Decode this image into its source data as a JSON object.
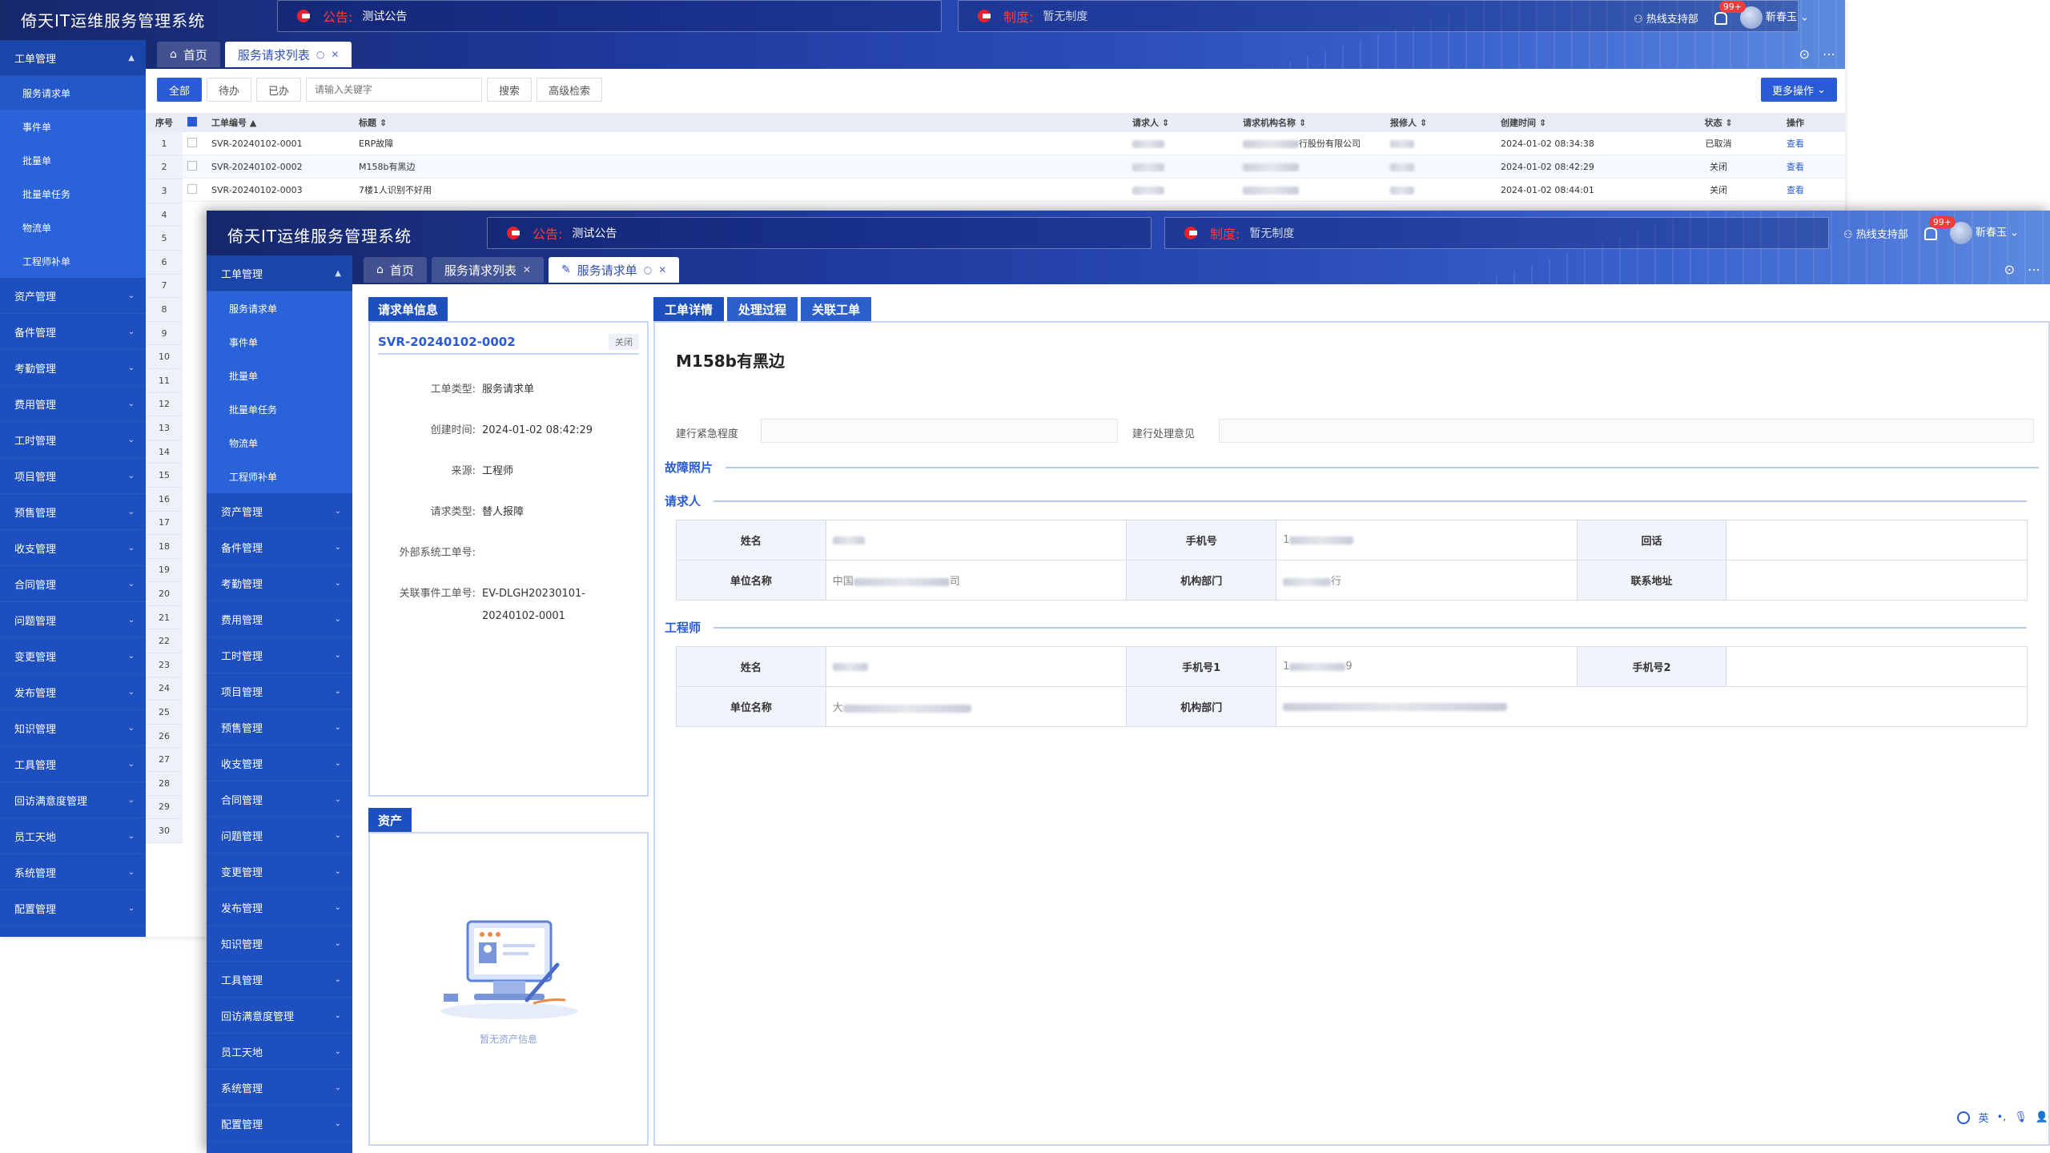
{
  "app": {
    "title": "倚天IT运维服务管理系统",
    "notice_tag": "公告:",
    "notice_text": "测试公告",
    "policy_tag": "制度:",
    "policy_text": "暂无制度",
    "hotline": "热线支持部",
    "badge": "99+",
    "user": "靳春玉"
  },
  "back": {
    "tabs": [
      "首页",
      "服务请求列表"
    ],
    "toolbar": {
      "all": "全部",
      "pending": "待办",
      "done": "已办",
      "search_placeholder": "请输入关键字",
      "search": "搜索",
      "advanced": "高级检索",
      "more": "更多操作"
    },
    "columns": {
      "seq": "序号",
      "code": "工单编号",
      "title": "标题",
      "requester": "请求人",
      "org": "请求机构名称",
      "reporter": "报修人",
      "created": "创建时间",
      "status": "状态",
      "action": "操作"
    },
    "rows": [
      {
        "code": "SVR-20240102-0001",
        "title": "ERP故障",
        "org_suffix": "行股份有限公司",
        "created": "2024-01-02 08:34:38",
        "status": "已取消",
        "action": "查看"
      },
      {
        "code": "SVR-20240102-0002",
        "title": "M158b有黑边",
        "org_suffix": "",
        "created": "2024-01-02 08:42:29",
        "status": "关闭",
        "action": "查看"
      },
      {
        "code": "SVR-20240102-0003",
        "title": "7楼1人识别不好用",
        "org_suffix": "",
        "created": "2024-01-02 08:44:01",
        "status": "关闭",
        "action": "查看"
      }
    ],
    "row_numbers": [
      "1",
      "2",
      "3",
      "4",
      "5",
      "6",
      "7",
      "8",
      "9",
      "10",
      "11",
      "12",
      "13",
      "14",
      "15",
      "16",
      "17",
      "18",
      "19",
      "20",
      "21",
      "22",
      "23",
      "24",
      "25",
      "26",
      "27",
      "28",
      "29",
      "30"
    ]
  },
  "sidebar": {
    "open_group": "工单管理",
    "sub_items": [
      "服务请求单",
      "事件单",
      "批量单",
      "批量单任务",
      "物流单",
      "工程师补单"
    ],
    "groups": [
      "资产管理",
      "备件管理",
      "考勤管理",
      "费用管理",
      "工时管理",
      "项目管理",
      "预售管理",
      "收支管理",
      "合同管理",
      "问题管理",
      "变更管理",
      "发布管理",
      "知识管理",
      "工具管理",
      "回访满意度管理",
      "员工天地",
      "系统管理",
      "配置管理"
    ]
  },
  "front": {
    "tabs": [
      "首页",
      "服务请求列表",
      "服务请求单"
    ],
    "info": {
      "tag": "请求单信息",
      "code": "SVR-20240102-0002",
      "status": "关闭",
      "fields": [
        {
          "k": "工单类型:",
          "v": "服务请求单"
        },
        {
          "k": "创建时间:",
          "v": "2024-01-02 08:42:29"
        },
        {
          "k": "来源:",
          "v": "工程师"
        },
        {
          "k": "请求类型:",
          "v": "替人报障"
        },
        {
          "k": "外部系统工单号:",
          "v": ""
        },
        {
          "k": "关联事件工单号:",
          "v": "EV-DLGH20230101-20240102-0001"
        }
      ]
    },
    "asset": {
      "tag": "资产",
      "empty": "暂无资产信息"
    },
    "detail": {
      "tabs": [
        "工单详情",
        "处理过程",
        "关联工单"
      ],
      "title": "M158b有黑边",
      "urgency_label": "建行紧急程度",
      "opinion_label": "建行处理意见",
      "photos": "故障照片",
      "requester_section": "请求人",
      "engineer_section": "工程师",
      "req_labels": {
        "name": "姓名",
        "phone": "手机号",
        "callback": "回话",
        "unit": "单位名称",
        "dept": "机构部门",
        "address": "联系地址"
      },
      "req_values": {
        "phone_prefix": "1",
        "unit_prefix": "中国",
        "unit_suffix": "司",
        "dept_suffix": "行"
      },
      "eng_labels": {
        "name": "姓名",
        "phone1": "手机号1",
        "phone2": "手机号2",
        "unit": "单位名称",
        "dept": "机构部门"
      },
      "eng_values": {
        "phone_prefix": "1",
        "phone_suffix": "9",
        "unit_prefix": "大"
      }
    },
    "ime": [
      "英"
    ]
  },
  "colors": {
    "accent": "#2a5bd7",
    "sidebar": "#1d4fbf",
    "header": "#1f3a9e",
    "danger": "#e8222c"
  }
}
